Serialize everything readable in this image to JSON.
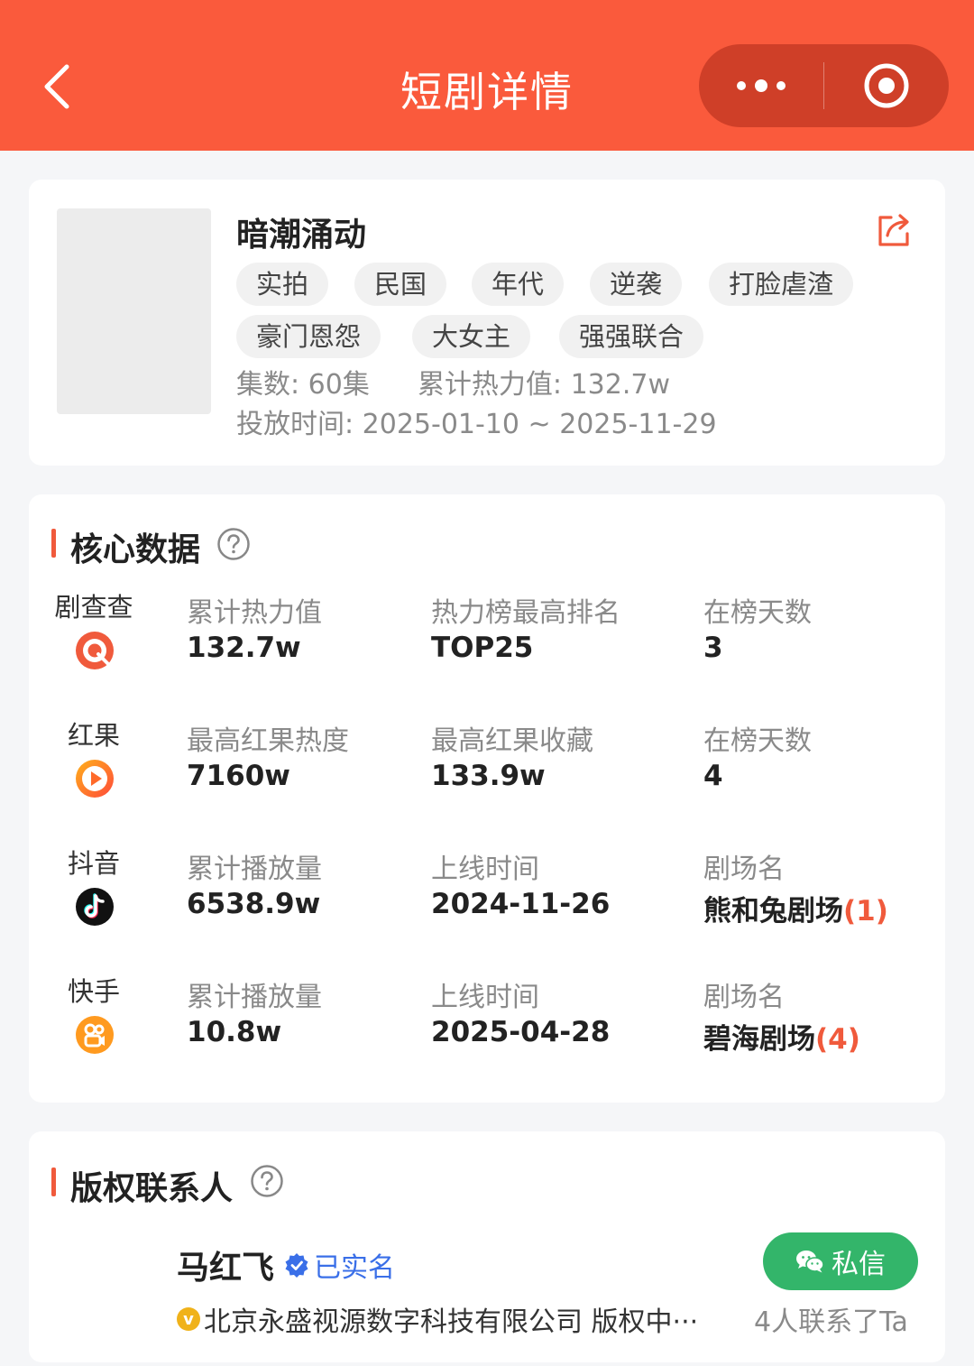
{
  "header": {
    "title": "短剧详情"
  },
  "drama": {
    "title": "暗潮涌动",
    "tags": [
      "实拍",
      "民国",
      "年代",
      "逆袭",
      "打脸虐渣",
      "豪门恩怨",
      "大女主",
      "强强联合"
    ],
    "episodes_label": "集数:",
    "episodes_value": "60集",
    "heat_label": "累计热力值:",
    "heat_value": "132.7w",
    "period_label": "投放时间:",
    "period_value": "2025-01-10 ~ 2025-11-29"
  },
  "core": {
    "title": "核心数据",
    "rows": [
      {
        "platform": "剧查查",
        "icon": "juchacha-icon",
        "c1_label": "累计热力值",
        "c1_value": "132.7w",
        "c2_label": "热力榜最高排名",
        "c2_value": "TOP25",
        "c3_label": "在榜天数",
        "c3_value": "3",
        "c3_count": ""
      },
      {
        "platform": "红果",
        "icon": "hongguo-icon",
        "c1_label": "最高红果热度",
        "c1_value": "7160w",
        "c2_label": "最高红果收藏",
        "c2_value": "133.9w",
        "c3_label": "在榜天数",
        "c3_value": "4",
        "c3_count": ""
      },
      {
        "platform": "抖音",
        "icon": "douyin-icon",
        "c1_label": "累计播放量",
        "c1_value": "6538.9w",
        "c2_label": "上线时间",
        "c2_value": "2024-11-26",
        "c3_label": "剧场名",
        "c3_value": "熊和兔剧场",
        "c3_count": "(1)"
      },
      {
        "platform": "快手",
        "icon": "kuaishou-icon",
        "c1_label": "累计播放量",
        "c1_value": "10.8w",
        "c2_label": "上线时间",
        "c2_value": "2025-04-28",
        "c3_label": "剧场名",
        "c3_value": "碧海剧场",
        "c3_count": "(4)"
      }
    ]
  },
  "contact": {
    "title": "版权联系人",
    "name": "马红飞",
    "verified_label": "已实名",
    "message_label": "私信",
    "badge_letter": "v",
    "company": "北京永盛视源数字科技有限公司 版权中···",
    "contact_count": "4人联系了Ta"
  },
  "colors": {
    "header_bg": "#fa5a3c",
    "accent": "#f05a3c",
    "verified_blue": "#3a6fe8",
    "message_green": "#33b56a"
  }
}
